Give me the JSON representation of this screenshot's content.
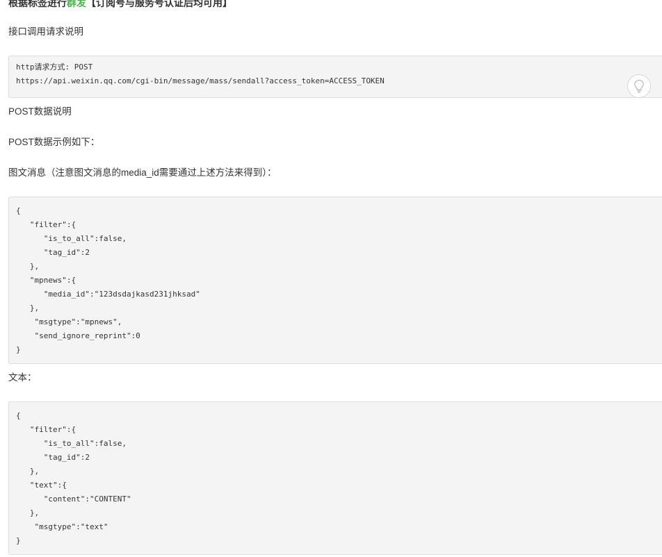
{
  "heading": {
    "prefix": "根据标签进行",
    "accent": "群发",
    "suffix": "【订阅号与服务号认证后均可用】"
  },
  "request_desc": "接口调用请求说明",
  "http_block": {
    "lines": [
      "http请求方式: POST",
      "https://api.weixin.qq.com/cgi-bin/message/mass/sendall?access_token=ACCESS_TOKEN"
    ],
    "tip_icon": "lightbulb-icon"
  },
  "post_desc": "POST数据说明",
  "post_example": "POST数据示例如下：",
  "mpnews_label": "图文消息（注意图文消息的media_id需要通过上述方法来得到）：",
  "mpnews_block": {
    "lines": [
      "{",
      "   \"filter\":{",
      "      \"is_to_all\":false,",
      "      \"tag_id\":2",
      "   },",
      "   \"mpnews\":{",
      "      \"media_id\":\"123dsdajkasd231jhksad\"",
      "   },",
      "    \"msgtype\":\"mpnews\",",
      "    \"send_ignore_reprint\":0",
      "}"
    ]
  },
  "text_label": "文本：",
  "text_block": {
    "lines": [
      "{",
      "   \"filter\":{",
      "      \"is_to_all\":false,",
      "      \"tag_id\":2",
      "   },",
      "   \"text\":{",
      "      \"content\":\"CONTENT\"",
      "   },",
      "    \"msgtype\":\"text\"",
      "}"
    ]
  }
}
